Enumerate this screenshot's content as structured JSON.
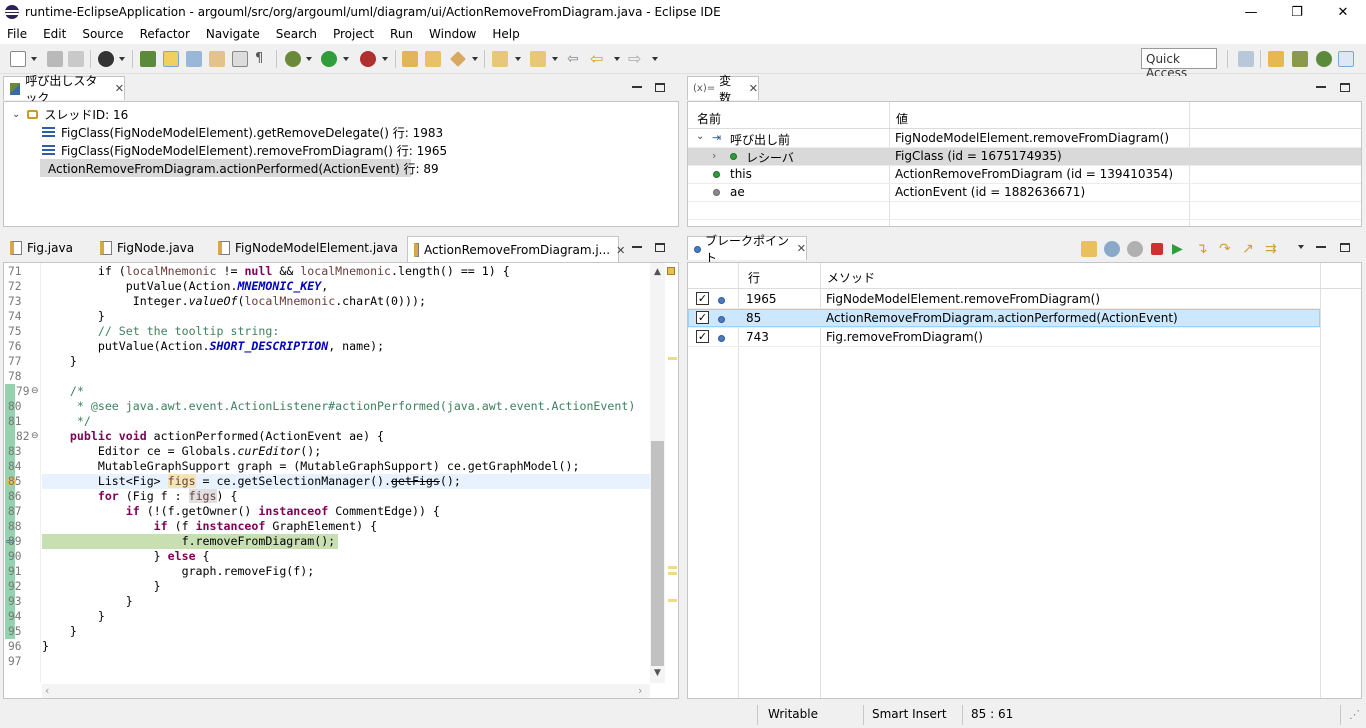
{
  "window": {
    "title": "runtime-EclipseApplication - argouml/src/org/argouml/uml/diagram/ui/ActionRemoveFromDiagram.java - Eclipse IDE",
    "minimize_glyph": "—",
    "restore_glyph": "❐",
    "close_glyph": "✕"
  },
  "menubar": [
    "File",
    "Edit",
    "Source",
    "Refactor",
    "Navigate",
    "Search",
    "Project",
    "Run",
    "Window",
    "Help"
  ],
  "toolbar": {
    "quick_access": "Quick Access"
  },
  "callstack": {
    "tab_label": "呼び出しスタック",
    "thread_label": "スレッドID: 16",
    "frames": [
      "FigClass(FigNodeModelElement).getRemoveDelegate() 行: 1983",
      "FigClass(FigNodeModelElement).removeFromDiagram() 行: 1965",
      "ActionRemoveFromDiagram.actionPerformed(ActionEvent) 行: 89"
    ],
    "selected_index": 2
  },
  "variables": {
    "tab_prefix": "(x)=",
    "tab_label": "変数",
    "col_name": "名前",
    "col_value": "値",
    "rows": [
      {
        "name": "呼び出し前",
        "value": "FigNodeModelElement.removeFromDiagram()"
      },
      {
        "name": "レシーバ",
        "value": "FigClass (id = 1675174935)"
      },
      {
        "name": "this",
        "value": "ActionRemoveFromDiagram (id = 139410354)"
      },
      {
        "name": "ae",
        "value": "ActionEvent (id = 1882636671)"
      }
    ]
  },
  "editor": {
    "tabs": [
      "Fig.java",
      "FigNode.java",
      "FigNodeModelElement.java",
      "ActionRemoveFromDiagram.j..."
    ],
    "active_tab": 3,
    "line_numbers": [
      "71",
      "72",
      "73",
      "74",
      "75",
      "76",
      "77",
      "78",
      "79",
      "80",
      "81",
      "82",
      "83",
      "84",
      "85",
      "86",
      "87",
      "88",
      "89",
      "90",
      "91",
      "92",
      "93",
      "94",
      "95",
      "96",
      "97"
    ],
    "code": {
      "l71a": "        if (",
      "l71b": "localMnemonic",
      "l71c": " != ",
      "l71d": "null",
      "l71e": " && ",
      "l71f": "localMnemonic",
      "l71g": ".length() == 1) {",
      "l72a": "            putValue(Action.",
      "l72b": "MNEMONIC_KEY",
      "l72c": ",",
      "l73a": "             Integer.",
      "l73b": "valueOf",
      "l73c": "(",
      "l73d": "localMnemonic",
      "l73e": ".charAt(0)));",
      "l74": "        }",
      "l75": "        // Set the tooltip string:",
      "l76a": "        putValue(Action.",
      "l76b": "SHORT_DESCRIPTION",
      "l76c": ", name);",
      "l77": "    }",
      "l79": "    /*",
      "l80": "     * @see java.awt.event.ActionListener#actionPerformed(java.awt.event.ActionEvent)",
      "l81": "     */",
      "l82a": "    public void",
      "l82b": " actionPerformed(ActionEvent ae) {",
      "l83a": "        Editor ce = Globals.",
      "l83b": "curEditor",
      "l83c": "();",
      "l84": "        MutableGraphSupport graph = (MutableGraphSupport) ce.getGraphModel();",
      "l85a": "        List<Fig> ",
      "l85b": "figs",
      "l85c": " = ce.getSelectionManager().",
      "l85d": "getFigs",
      "l85e": "();",
      "l86a": "        for",
      "l86b": " (Fig f : ",
      "l86c": "figs",
      "l86d": ") {",
      "l87a": "            if",
      "l87b": " (!(f.getOwner() ",
      "l87c": "instanceof",
      "l87d": " CommentEdge)) {",
      "l88a": "                if",
      "l88b": " (f ",
      "l88c": "instanceof",
      "l88d": " GraphElement) {",
      "l89": "                    f.removeFromDiagram();",
      "l90a": "                } ",
      "l90b": "else",
      "l90c": " {",
      "l91": "                    graph.removeFig(f);",
      "l92": "                }",
      "l93": "            }",
      "l94": "        }",
      "l95": "    }",
      "l96": "}"
    }
  },
  "breakpoints": {
    "tab_label": "ブレークポイント",
    "col_line": "行",
    "col_method": "メソッド",
    "rows": [
      {
        "checked": "✓",
        "line": "1965",
        "method": "FigNodeModelElement.removeFromDiagram()"
      },
      {
        "checked": "✓",
        "line": "85",
        "method": "ActionRemoveFromDiagram.actionPerformed(ActionEvent)"
      },
      {
        "checked": "✓",
        "line": "743",
        "method": "Fig.removeFromDiagram()"
      }
    ],
    "selected_index": 1
  },
  "statusbar": {
    "writable": "Writable",
    "insert_mode": "Smart Insert",
    "position": "85 : 61"
  },
  "colors": {
    "current_line": "#c8dfb2",
    "selected_row": "#cce8ff",
    "keyword": "#7f0055",
    "comment": "#3f7f5f",
    "field": "#0000c0"
  }
}
